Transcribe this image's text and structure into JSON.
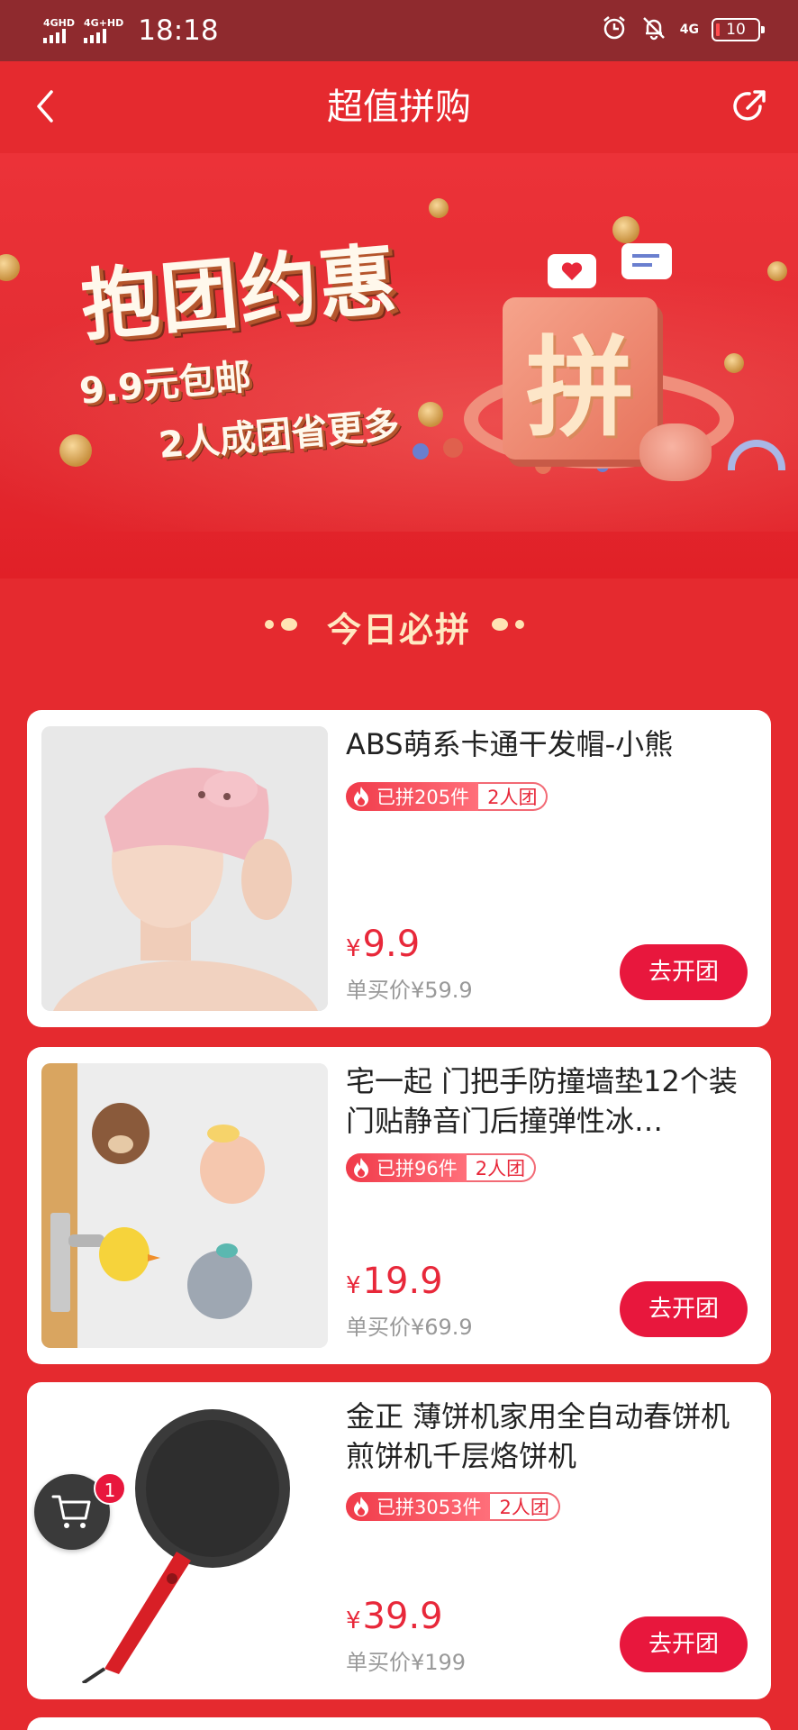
{
  "status_bar": {
    "sim1": "4GHD",
    "sim2": "4G+HD",
    "time": "18:18",
    "net": "4G",
    "battery": "10"
  },
  "header": {
    "title": "超值拼购",
    "back_icon": "chevron-left-icon",
    "share_icon": "share-icon"
  },
  "banner": {
    "headline": "抱团约惠",
    "line1": "9.9元包邮",
    "line2": "2人成团省更多",
    "emblem": "拼"
  },
  "section": {
    "title": "今日必拼"
  },
  "products": [
    {
      "title": "ABS萌系卡通干发帽-小熊",
      "sold": "已拼205件",
      "group": "2人团",
      "currency": "¥",
      "price": "9.9",
      "original": "单买价¥59.9",
      "button": "去开团"
    },
    {
      "title": "宅一起 门把手防撞墙垫12个装 门贴静音门后撞弹性冰…",
      "sold": "已拼96件",
      "group": "2人团",
      "currency": "¥",
      "price": "19.9",
      "original": "单买价¥69.9",
      "button": "去开团"
    },
    {
      "title": "金正 薄饼机家用全自动春饼机煎饼机千层烙饼机",
      "sold": "已拼3053件",
      "group": "2人团",
      "currency": "¥",
      "price": "39.9",
      "original": "单买价¥199",
      "button": "去开团"
    }
  ],
  "cart": {
    "icon": "cart-icon",
    "badge": "1"
  },
  "colors": {
    "primary_red": "#e52a2f",
    "status_bar": "#8f2a2e",
    "button_red": "#e8173d",
    "price_red": "#e8283a"
  }
}
